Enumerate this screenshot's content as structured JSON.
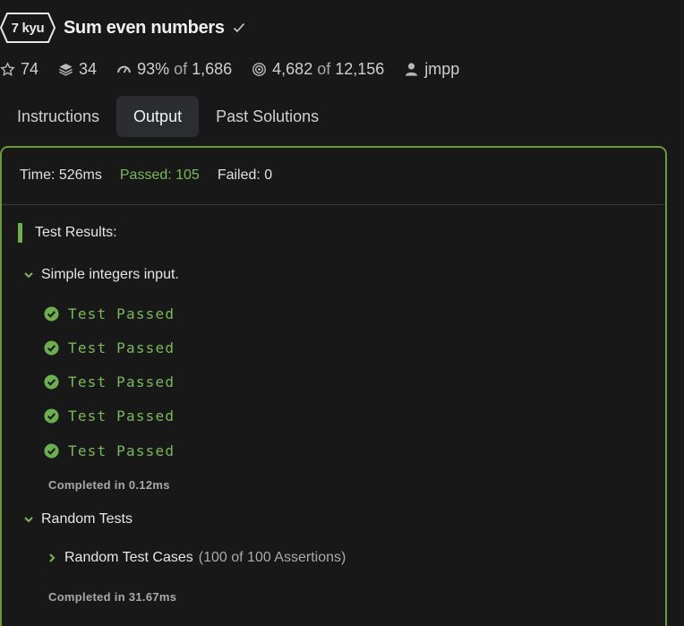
{
  "kata": {
    "rank": "7 kyu",
    "title": "Sum even numbers"
  },
  "stats": {
    "stars": "74",
    "collections": "34",
    "satisfaction_percent": "93%",
    "of_label": "of",
    "votes": "1,686",
    "completed": "4,682",
    "attempts": "12,156",
    "author": "jmpp"
  },
  "tabs": [
    "Instructions",
    "Output",
    "Past Solutions"
  ],
  "active_tab": "Output",
  "summary": {
    "time": "Time: 526ms",
    "passed": "Passed: 105",
    "failed": "Failed: 0"
  },
  "results": {
    "title": "Test Results:",
    "groups": [
      {
        "name": "Simple integers input.",
        "tests": [
          "Test Passed",
          "Test Passed",
          "Test Passed",
          "Test Passed",
          "Test Passed"
        ],
        "completed": "Completed in 0.12ms"
      },
      {
        "name": "Random Tests",
        "subgroup": "Random Test Cases",
        "assertions": "(100 of 100 Assertions)",
        "completed": "Completed in 31.67ms"
      }
    ]
  },
  "colors": {
    "background": "#181818",
    "accent_green": "#7ab85a",
    "panel_border": "#6a9a36"
  },
  "icons": {
    "rank": "hexagon-badge",
    "verified": "check-icon",
    "stars": "star-icon",
    "collections": "stack-icon",
    "satisfaction": "gauge-icon",
    "completed": "target-icon",
    "author": "user-icon",
    "test_pass": "check-circle-icon"
  }
}
